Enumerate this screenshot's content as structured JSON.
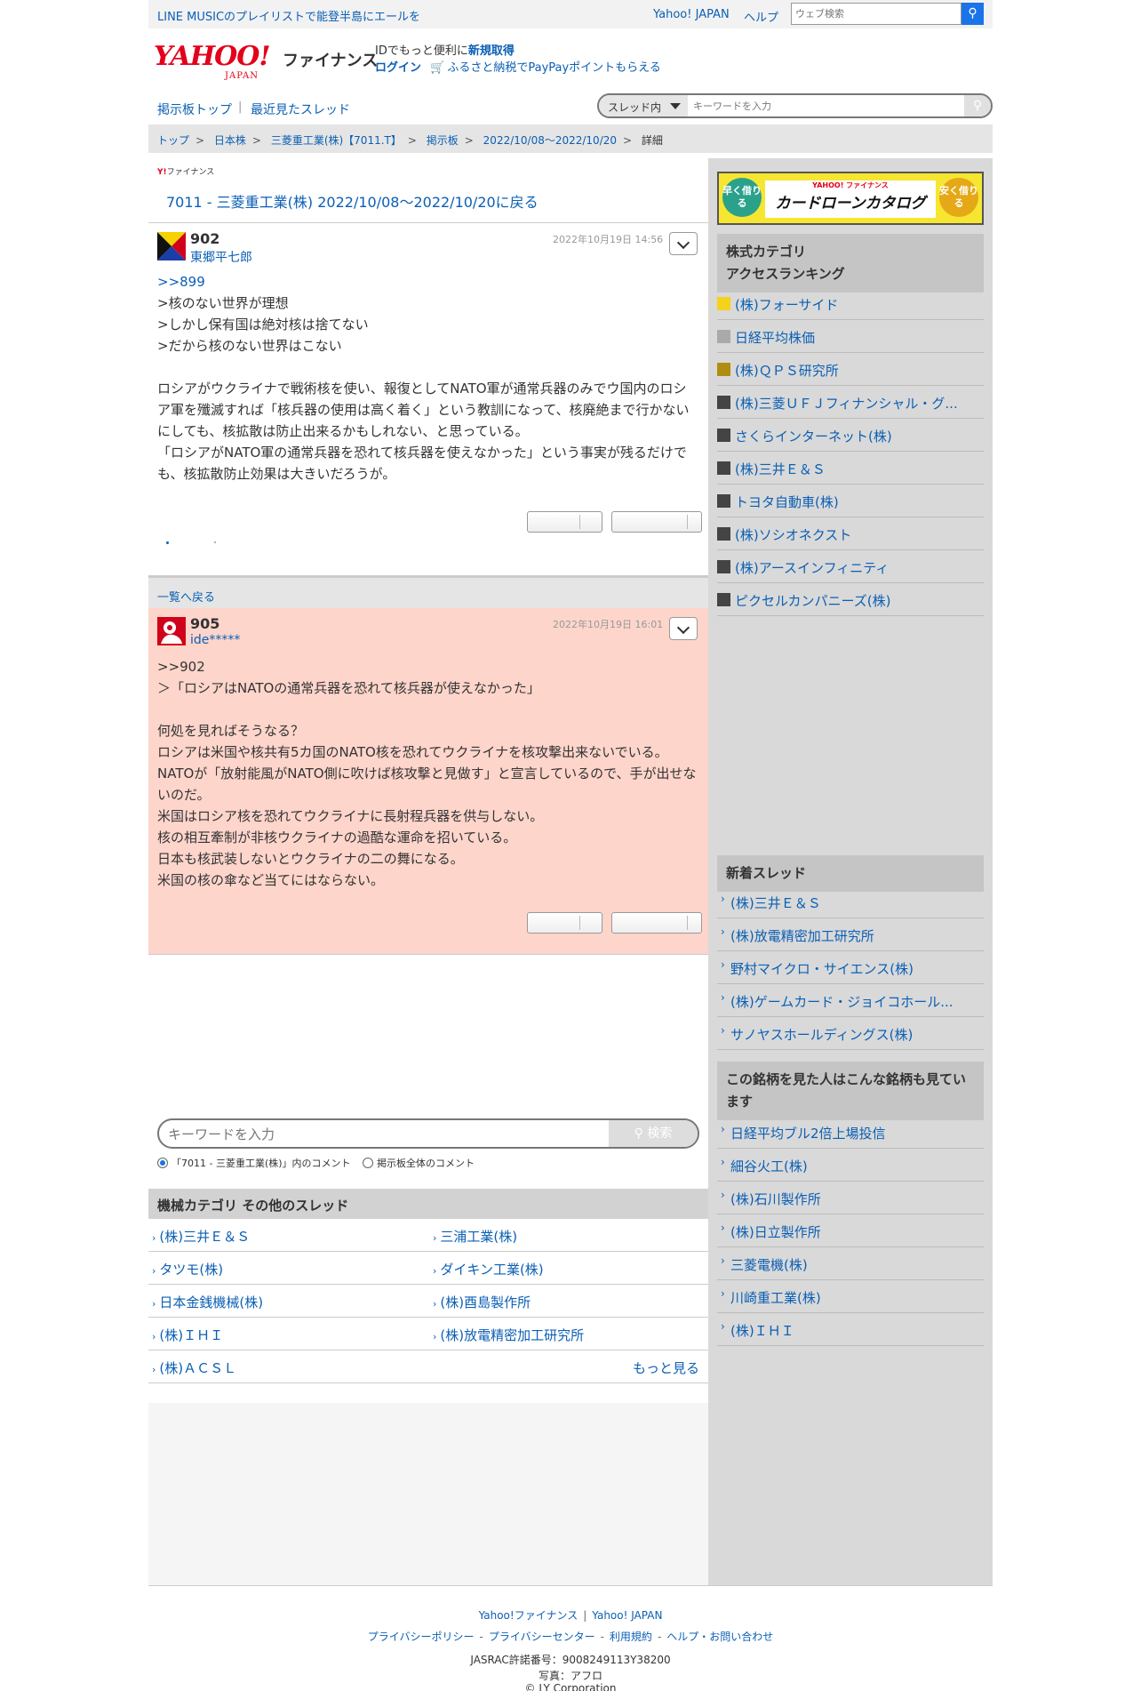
{
  "topbar": {
    "promo": "LINE MUSICのプレイリストで能登半島にエールを",
    "yahoo_japan": "Yahoo! JAPAN",
    "help": "ヘルプ",
    "web_search_placeholder": "ウェブ検索"
  },
  "header": {
    "logo_main": "YAHOO!",
    "logo_sub": "JAPAN",
    "logo_finance": "ファイナンス",
    "id_prefix": "IDでもっと便利に",
    "register": "新規取得",
    "login": "ログイン",
    "furusato": "ふるさと納税でPayPayポイントもらえる"
  },
  "nav": {
    "board_top": "掲示板トップ",
    "separator": "|",
    "recent": "最近見たスレッド",
    "scope": "スレッド内",
    "keyword_placeholder": "キーワードを入力"
  },
  "breadcrumb": [
    "トップ",
    "日本株",
    "三菱重工業(株)【7011.T】",
    "掲示板",
    "2022/10/08〜2022/10/20",
    "詳細"
  ],
  "thread": {
    "mini_logo_y": "Y!",
    "mini_logo_text": "ファイナンス",
    "back_title": "7011 - 三菱重工業(株) 2022/10/08〜2022/10/20に戻る"
  },
  "posts": [
    {
      "number": "902",
      "user": "東郷平七郎",
      "date": "2022年10月19日 14:56",
      "anchor": ">>899",
      "text": ">核のない世界が理想\n>しかし保有国は絶対核は捨てない\n>だから核のない世界はこない\n\nロシアがウクライナで戦術核を使い、報復としてNATO軍が通常兵器のみでウ国内のロシア軍を殲滅すれば「核兵器の使用は高く着く」という教訓になって、核廃絶まで行かないにしても、核拡散は防止出来るかもしれない、と思っている。\n「ロシアがNATO軍の通常兵器を恐れて核兵器を使えなかった」という事実が残るだけでも、核拡散防止効果は大きいだろうが。"
    },
    {
      "number": "905",
      "user": "ide*****",
      "date": "2022年10月19日 16:01",
      "anchor": "",
      "text": ">>902\n＞「ロシアはNATOの通常兵器を恐れて核兵器が使えなかった」\n\n何処を見ればそうなる？\nロシアは米国や核共有5カ国のNATO核を恐れてウクライナを核攻撃出来ないでいる。\nNATOが「放射能風がNATO側に吹けば核攻撃と見做す」と宣言しているので、手が出せないのだ。\n米国はロシア核を恐れてウクライナに長射程兵器を供与しない。\n核の相互牽制が非核ウクライナの過酷な運命を招いている。\n日本も核武装しないとウクライナの二の舞になる。\n米国の核の傘など当てにはならない。"
    }
  ],
  "list_back": "一覧へ戻る",
  "bottom_search": {
    "placeholder": "キーワードを入力",
    "button": "検索",
    "radio1": "「7011 - 三菱重工業(株)」内のコメント",
    "radio2": "掲示板全体のコメント"
  },
  "other_threads": {
    "title": "機械カテゴリ その他のスレッド",
    "items": [
      "(株)三井Ｅ＆Ｓ",
      "三浦工業(株)",
      "タツモ(株)",
      "ダイキン工業(株)",
      "日本金銭機械(株)",
      "(株)酉島製作所",
      "(株)ＩＨＩ",
      "(株)放電精密加工研究所",
      "(株)ＡＣＳＬ"
    ],
    "more": "もっと見る"
  },
  "sidebar": {
    "banner": {
      "left": "早く借りる",
      "top": "YAHOO! ファイナンス",
      "main": "カードローンカタログ",
      "right": "安く借りる"
    },
    "ranking_title": "株式カテゴリ\nアクセスランキング",
    "ranking": [
      {
        "name": "(株)フォーサイド",
        "color": "#f5d21b"
      },
      {
        "name": "日経平均株価",
        "color": "#aaaaaa"
      },
      {
        "name": "(株)ＱＰＳ研究所",
        "color": "#b08d10"
      },
      {
        "name": "(株)三菱ＵＦＪフィナンシャル・グ...",
        "color": "#444444"
      },
      {
        "name": "さくらインターネット(株)",
        "color": "#444444"
      },
      {
        "name": "(株)三井Ｅ＆Ｓ",
        "color": "#444444"
      },
      {
        "name": "トヨタ自動車(株)",
        "color": "#444444"
      },
      {
        "name": "(株)ソシオネクスト",
        "color": "#444444"
      },
      {
        "name": "(株)アースインフィニティ",
        "color": "#444444"
      },
      {
        "name": "ピクセルカンパニーズ(株)",
        "color": "#444444"
      }
    ],
    "new_title": "新着スレッド",
    "new_threads": [
      "(株)三井Ｅ＆Ｓ",
      "(株)放電精密加工研究所",
      "野村マイクロ・サイエンス(株)",
      "(株)ゲームカード・ジョイコホール...",
      "サノヤスホールディングス(株)"
    ],
    "also_title": "この銘柄を見た人はこんな銘柄も見ています",
    "also": [
      "日経平均ブル2倍上場投信",
      "細谷火工(株)",
      "(株)石川製作所",
      "(株)日立製作所",
      "三菱電機(株)",
      "川崎重工業(株)",
      "(株)ＩＨＩ"
    ]
  },
  "footer": {
    "yfin": "Yahoo!ファイナンス",
    "yjapan": "Yahoo! JAPAN",
    "privacy_policy": "プライバシーポリシー",
    "privacy_center": "プライバシーセンター",
    "terms": "利用規約",
    "help": "ヘルプ・お問い合わせ",
    "jasrac": "JASRAC許諾番号：9008249113Y38200",
    "photo": "写真：アフロ",
    "copyright": "© LY Corporation"
  }
}
